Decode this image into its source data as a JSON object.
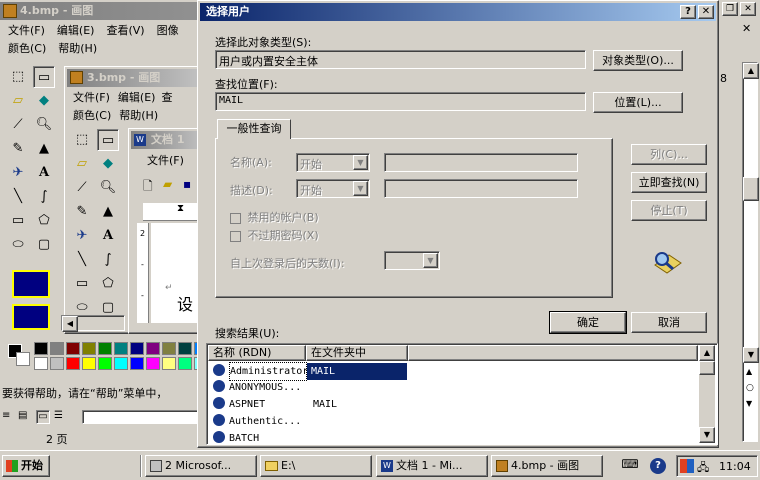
{
  "bg_window": {
    "title": "4.bmp - 画图",
    "menu": [
      "文件(F)",
      "编辑(E)",
      "查看(V)",
      "图像",
      "颜色(C)",
      "帮助(H)"
    ],
    "status_help": "要获得帮助，请在“帮助”菜单中，",
    "status_tail": "2 页"
  },
  "mid_window": {
    "title": "3.bmp - 画图",
    "menu": [
      "文件(F)",
      "编辑(E)",
      "查",
      "颜色(C)",
      "帮助(H)"
    ]
  },
  "word_window": {
    "title": "文档 1",
    "menu": [
      "文件(F)"
    ],
    "text_char": "设"
  },
  "right_strip": {
    "number": "8"
  },
  "dialog": {
    "title": "选择用户",
    "object_type_label": "选择此对象类型(S):",
    "object_type_value": "用户或内置安全主体",
    "object_type_button": "对象类型(O)...",
    "location_label": "查找位置(F):",
    "location_value": "MAIL",
    "location_button": "位置(L)...",
    "tab_label": "一般性查询",
    "name_label": "名称(A):",
    "name_mode": "开始",
    "desc_label": "描述(D):",
    "desc_mode": "开始",
    "disabled_accounts": "禁用的帐户(B)",
    "non_expiring_pwd": "不过期密码(X)",
    "days_since_logon": "自上次登录后的天数(I):",
    "columns_button": "列(C)...",
    "find_now_button": "立即查找(N)",
    "stop_button": "停止(T)",
    "ok_button": "确定",
    "cancel_button": "取消",
    "results_label": "搜索结果(U):",
    "columns": [
      "名称 (RDN)",
      "在文件夹中"
    ],
    "results": [
      {
        "name": "Administrator",
        "folder": "MAIL"
      },
      {
        "name": "ANONYMOUS...",
        "folder": ""
      },
      {
        "name": "ASPNET",
        "folder": "MAIL"
      },
      {
        "name": "Authentic...",
        "folder": ""
      },
      {
        "name": "BATCH",
        "folder": ""
      }
    ]
  },
  "taskbar": {
    "start": "开始",
    "items": [
      "2 Microsof...",
      "E:\\",
      "文档 1 - Mi...",
      "4.bmp - 画图"
    ],
    "clock": "11:04"
  },
  "palette": [
    "#000000",
    "#808080",
    "#800000",
    "#808000",
    "#008000",
    "#008080",
    "#000080",
    "#800080",
    "#808040",
    "#004040",
    "#0080ff",
    "#004080",
    "#8000ff",
    "#804000",
    "#ffffff",
    "#c0c0c0",
    "#ff0000",
    "#ffff00",
    "#00ff00",
    "#00ffff",
    "#0000ff",
    "#ff00ff",
    "#ffff80",
    "#00ff80",
    "#80ffff",
    "#8080ff",
    "#ff0080",
    "#ff8040"
  ]
}
